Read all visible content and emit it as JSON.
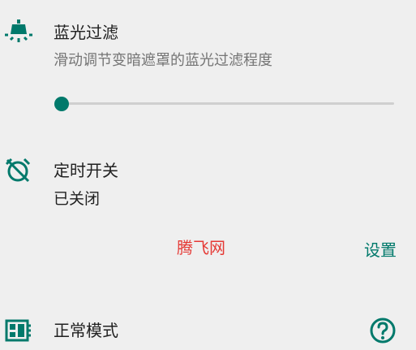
{
  "colors": {
    "accent": "#00796b",
    "background": "#efefef",
    "title_text": "#212121",
    "secondary_text": "#757575",
    "watermark": "#e53935"
  },
  "blue_light_filter": {
    "icon": "lamp-icon",
    "title": "蓝光过滤",
    "description": "滑动调节变暗遮罩的蓝光过滤程度",
    "level": 0
  },
  "timer": {
    "icon": "alarm-off-icon",
    "title": "定时开关",
    "status": "已关闭",
    "settings_label": "设置"
  },
  "watermark": {
    "text": "腾飞网"
  },
  "mode": {
    "icon": "dashboard-icon",
    "title": "正常模式",
    "help_icon": "help-circle-icon"
  }
}
